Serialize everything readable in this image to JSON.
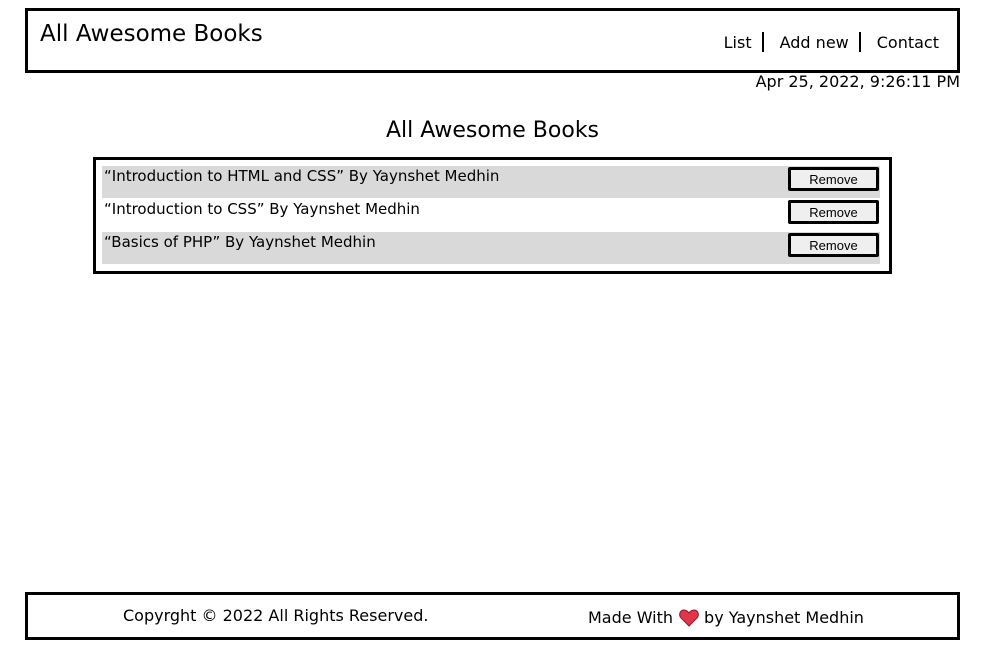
{
  "header": {
    "logo": "All Awesome Books",
    "nav": [
      "List",
      "Add new",
      "Contact"
    ]
  },
  "datetime": "Apr 25, 2022, 9:26:11 PM",
  "page_title": "All Awesome Books",
  "books": [
    {
      "text": "“Introduction to HTML and CSS” By Yaynshet Medhin",
      "button": "Remove"
    },
    {
      "text": "“Introduction to CSS” By Yaynshet Medhin",
      "button": "Remove"
    },
    {
      "text": "“Basics of PHP” By Yaynshet Medhin",
      "button": "Remove"
    }
  ],
  "footer": {
    "copyright": "Copyrght © 2022 All Rights Reserved.",
    "made_with": "Made With",
    "heart_icon": "heart-icon",
    "heart_color": "#e0354a",
    "by": "by Yaynshet Medhin"
  }
}
